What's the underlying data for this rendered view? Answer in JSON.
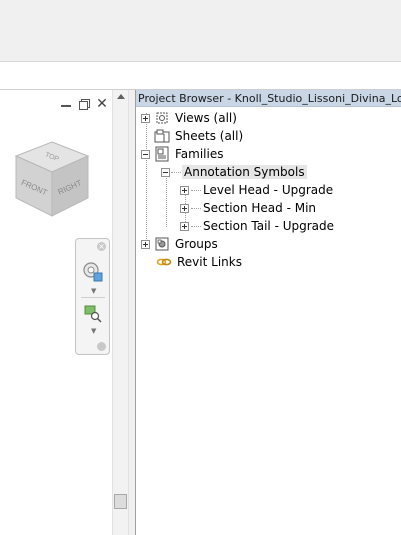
{
  "browser": {
    "title": "Project Browser - Knoll_Studio_Lissoni_Divina_Lo..."
  },
  "tree": {
    "views": "Views (all)",
    "sheets": "Sheets (all)",
    "families": "Families",
    "annotation_symbols": "Annotation Symbols",
    "level_head": "Level Head - Upgrade",
    "section_head": "Section Head - Min",
    "section_tail": "Section Tail - Upgrade",
    "groups": "Groups",
    "revit_links": "Revit Links"
  },
  "viewcube": {
    "top": "TOP",
    "front": "FRONT",
    "right": "RIGHT"
  },
  "icons": {
    "views": "views-icon",
    "sheets": "sheets-icon",
    "families": "families-icon",
    "groups": "groups-icon",
    "links": "link-icon"
  },
  "colors": {
    "title_bar": "#c9d6e6",
    "selection": "#e6e6e6",
    "link_icon": "#d9a520"
  }
}
